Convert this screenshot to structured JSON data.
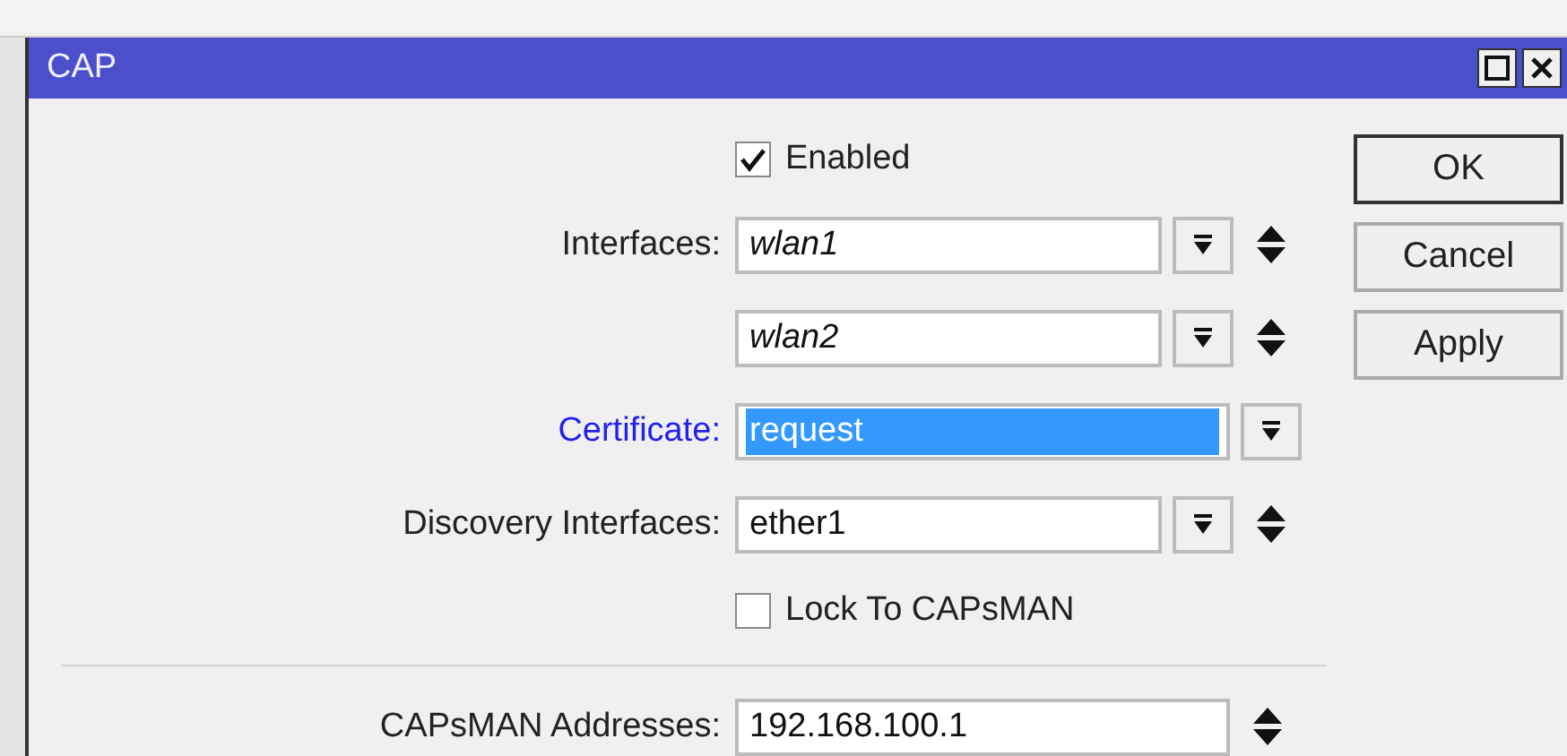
{
  "window": {
    "title": "CAP"
  },
  "rows": [
    {
      "kind": "checkbox",
      "label": "Enabled",
      "checked": true
    },
    {
      "kind": "field",
      "label": "Interfaces:",
      "value": "wlan1",
      "italic": true,
      "selected": false,
      "dropdown": true,
      "spin": true
    },
    {
      "kind": "field",
      "label": "",
      "value": "wlan2",
      "italic": true,
      "selected": false,
      "dropdown": true,
      "spin": true
    },
    {
      "kind": "field",
      "label": "Certificate:",
      "value": "request",
      "italic": false,
      "selected": true,
      "dropdown": true,
      "spin": false
    },
    {
      "kind": "field",
      "label": "Discovery Interfaces:",
      "value": "ether1",
      "italic": false,
      "selected": false,
      "dropdown": true,
      "spin": true
    },
    {
      "kind": "checkbox",
      "label": "Lock To CAPsMAN",
      "checked": false
    },
    {
      "kind": "separator"
    },
    {
      "kind": "field",
      "label": "CAPsMAN Addresses:",
      "value": "192.168.100.1",
      "italic": false,
      "selected": false,
      "dropdown": false,
      "spin": true
    }
  ],
  "buttons": [
    {
      "label": "OK",
      "default": true
    },
    {
      "label": "Cancel",
      "default": false
    },
    {
      "label": "Apply",
      "default": false
    }
  ]
}
